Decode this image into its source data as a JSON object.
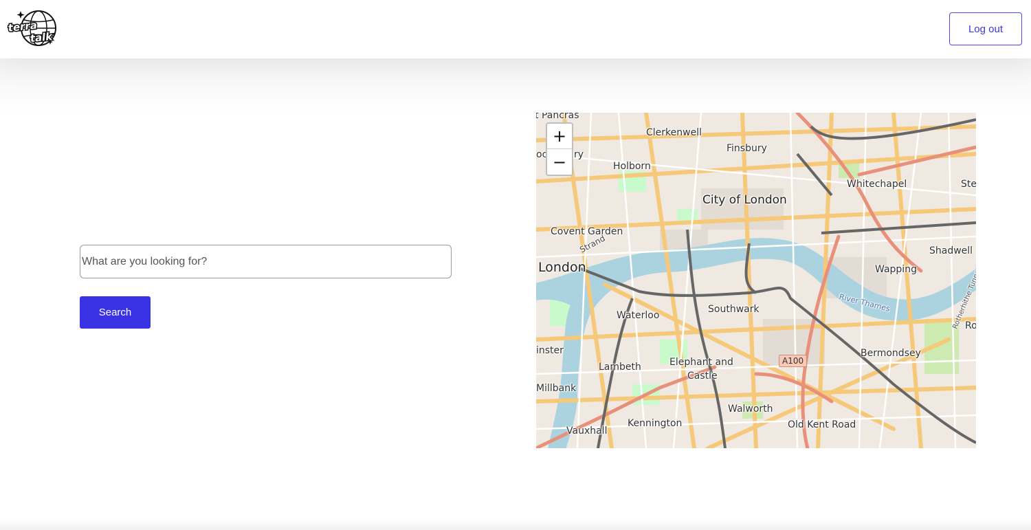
{
  "header": {
    "logo_text": "terra talk",
    "logout_label": "Log out"
  },
  "search": {
    "placeholder": "What are you looking for?",
    "value": "",
    "button_label": "Search"
  },
  "map": {
    "zoom_in_label": "+",
    "zoom_out_label": "−",
    "labels": {
      "st_pancras": "t Pancras",
      "clerkenwell": "Clerkenwell",
      "finsbury": "Finsbury",
      "bloomsbury": "ocmsbury",
      "holborn": "Holborn",
      "whitechapel": "Whitechapel",
      "stepney": "Ste",
      "city_of_london": "City of London",
      "covent_garden": "Covent Garden",
      "strand": "Strand",
      "shadwell": "Shadwell",
      "london": "London",
      "wapping": "Wapping",
      "river_thames": "River Thames",
      "rotherhithe_tunnel": "Rotherhithe Tunnel",
      "southwark": "Southwark",
      "waterloo": "Waterloo",
      "rotherhithe": "Ro",
      "westminster": "inster",
      "a100": "A100",
      "bermondsey": "Bermondsey",
      "lambeth": "Lambeth",
      "elephant": "Elephant and",
      "castle": "Castle",
      "millbank": "Millbank",
      "walworth": "Walworth",
      "kennington": "Kennington",
      "old_kent_road": "Old Kent Road",
      "vauxhall": "Vauxhall"
    }
  }
}
